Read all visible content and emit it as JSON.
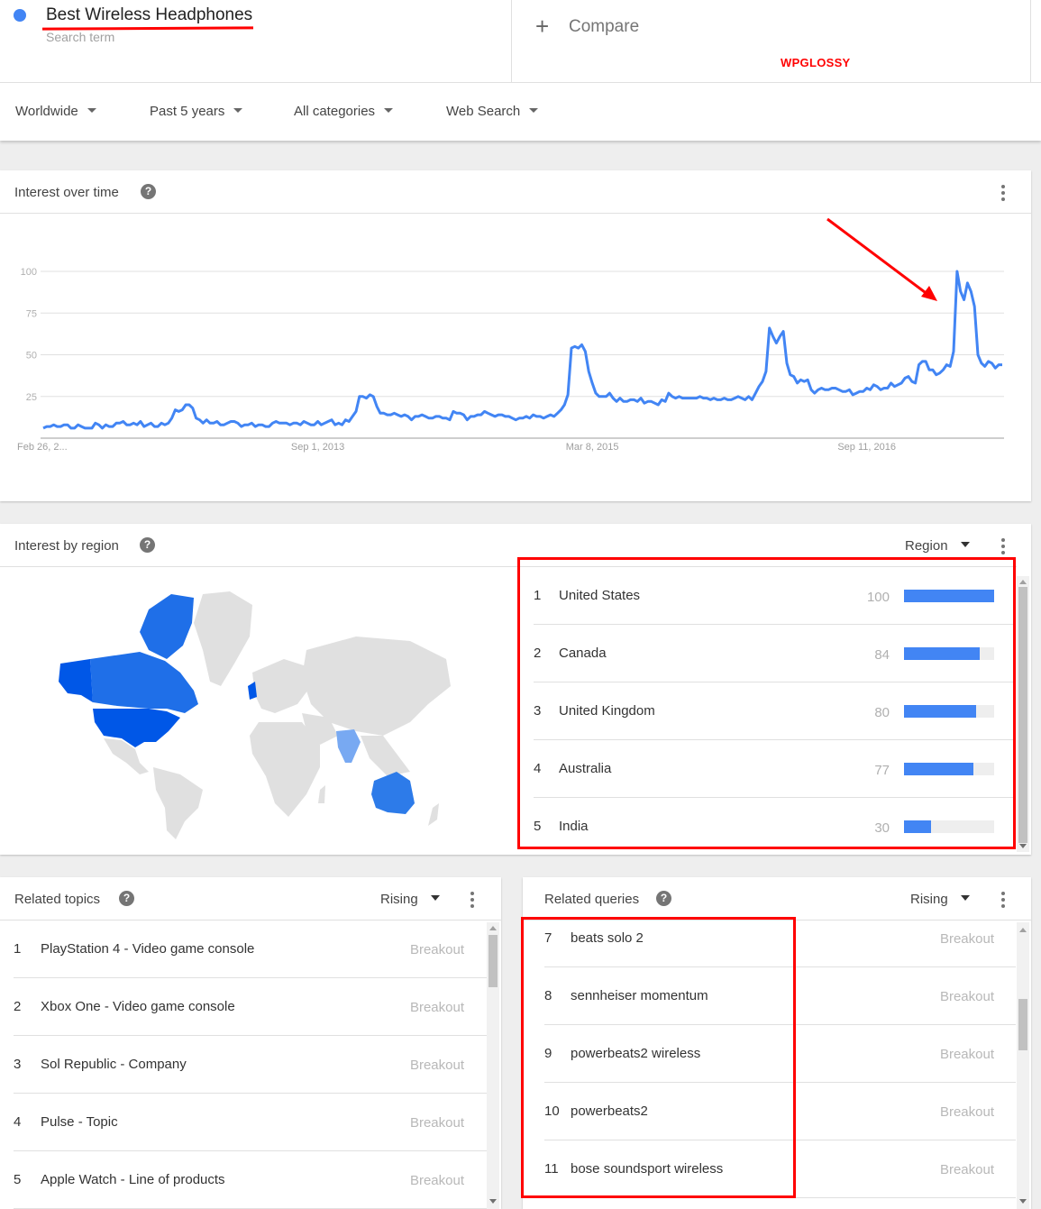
{
  "search": {
    "term": "Best Wireless Headphones",
    "term_sublabel": "Search term",
    "term_color": "#4285f4",
    "compare_label": "Compare",
    "compare_icon": "plus-icon",
    "watermark": "WPGLOSSY"
  },
  "filters": [
    {
      "label": "Worldwide"
    },
    {
      "label": "Past 5 years"
    },
    {
      "label": "All categories"
    },
    {
      "label": "Web Search"
    }
  ],
  "interest_over_time": {
    "title": "Interest over time",
    "help_icon": "?",
    "annotation": "red-arrow pointing to peak"
  },
  "chart_data": {
    "type": "line",
    "title": "Interest over time",
    "xlabel": "",
    "ylabel": "",
    "ylim": [
      0,
      100
    ],
    "yticks": [
      25,
      50,
      75,
      100
    ],
    "xtick_labels": [
      "Feb 26, 2...",
      "Sep 1, 2013",
      "Mar 8, 2015",
      "Sep 11, 2016"
    ],
    "xtick_index": [
      0,
      79,
      158,
      237
    ],
    "grid": true,
    "line_color": "#4285f4",
    "series": [
      {
        "name": "Best Wireless Headphones",
        "values": [
          6,
          7,
          7,
          8,
          7,
          7,
          8,
          8,
          6,
          6,
          8,
          7,
          6,
          6,
          6,
          9,
          8,
          6,
          8,
          7,
          7,
          9,
          9,
          10,
          8,
          8,
          9,
          8,
          10,
          7,
          8,
          9,
          7,
          7,
          9,
          8,
          9,
          12,
          17,
          16,
          17,
          20,
          20,
          18,
          12,
          11,
          9,
          11,
          9,
          9,
          10,
          8,
          8,
          9,
          10,
          10,
          9,
          7,
          8,
          8,
          9,
          7,
          8,
          8,
          7,
          7,
          9,
          10,
          9,
          9,
          9,
          8,
          9,
          9,
          8,
          10,
          9,
          8,
          8,
          10,
          8,
          9,
          10,
          11,
          8,
          9,
          8,
          11,
          10,
          13,
          16,
          25,
          25,
          24,
          26,
          25,
          19,
          15,
          15,
          14,
          14,
          15,
          14,
          13,
          14,
          13,
          11,
          13,
          13,
          14,
          13,
          12,
          12,
          13,
          13,
          12,
          12,
          11,
          16,
          15,
          15,
          14,
          11,
          13,
          13,
          14,
          14,
          16,
          15,
          14,
          13,
          14,
          14,
          13,
          13,
          12,
          11,
          12,
          12,
          13,
          12,
          14,
          13,
          13,
          12,
          13,
          14,
          13,
          15,
          17,
          20,
          26,
          54,
          55,
          54,
          56,
          52,
          40,
          33,
          27,
          25,
          25,
          25,
          27,
          24,
          22,
          24,
          22,
          22,
          23,
          23,
          22,
          24,
          21,
          22,
          22,
          21,
          20,
          23,
          22,
          27,
          25,
          24,
          25,
          24,
          24,
          24,
          24,
          24,
          25,
          24,
          24,
          23,
          24,
          23,
          23,
          24,
          23,
          23,
          24,
          25,
          24,
          23,
          25,
          23,
          27,
          31,
          34,
          40,
          66,
          61,
          57,
          61,
          64,
          45,
          38,
          37,
          33,
          35,
          34,
          35,
          29,
          27,
          29,
          30,
          29,
          29,
          30,
          30,
          29,
          28,
          28,
          29,
          26,
          27,
          28,
          28,
          30,
          29,
          32,
          31,
          29,
          30,
          30,
          33,
          31,
          32,
          33,
          36,
          37,
          34,
          33,
          44,
          46,
          46,
          41,
          41,
          38,
          39,
          41,
          44,
          43,
          52,
          100,
          88,
          83,
          93,
          88,
          79,
          50,
          45,
          43,
          46,
          45,
          42,
          44,
          44
        ]
      }
    ]
  },
  "interest_by_region": {
    "title": "Interest by region",
    "help_icon": "?",
    "select_label": "Region",
    "map_colors": {
      "max": "#0057e7",
      "high": "#1f6fe8",
      "mid": "#2d7be9",
      "low": "#78a9f2",
      "none": "#e0e0e0"
    },
    "rows": [
      {
        "rank": "1",
        "name": "United States",
        "value": "100",
        "fraction": 1.0
      },
      {
        "rank": "2",
        "name": "Canada",
        "value": "84",
        "fraction": 0.84
      },
      {
        "rank": "3",
        "name": "United Kingdom",
        "value": "80",
        "fraction": 0.8
      },
      {
        "rank": "4",
        "name": "Australia",
        "value": "77",
        "fraction": 0.77
      },
      {
        "rank": "5",
        "name": "India",
        "value": "30",
        "fraction": 0.3
      }
    ]
  },
  "related_topics": {
    "title": "Related topics",
    "help_icon": "?",
    "select_label": "Rising",
    "rows": [
      {
        "rank": "1",
        "name": "PlayStation 4 - Video game console",
        "value": "Breakout"
      },
      {
        "rank": "2",
        "name": "Xbox One - Video game console",
        "value": "Breakout"
      },
      {
        "rank": "3",
        "name": "Sol Republic - Company",
        "value": "Breakout"
      },
      {
        "rank": "4",
        "name": "Pulse - Topic",
        "value": "Breakout"
      },
      {
        "rank": "5",
        "name": "Apple Watch - Line of products",
        "value": "Breakout"
      }
    ]
  },
  "related_queries": {
    "title": "Related queries",
    "help_icon": "?",
    "select_label": "Rising",
    "rows": [
      {
        "rank": "7",
        "name": "beats solo 2",
        "value": "Breakout"
      },
      {
        "rank": "8",
        "name": "sennheiser momentum",
        "value": "Breakout"
      },
      {
        "rank": "9",
        "name": "powerbeats2 wireless",
        "value": "Breakout"
      },
      {
        "rank": "10",
        "name": "powerbeats2",
        "value": "Breakout"
      },
      {
        "rank": "11",
        "name": "bose soundsport wireless",
        "value": "Breakout"
      }
    ]
  }
}
